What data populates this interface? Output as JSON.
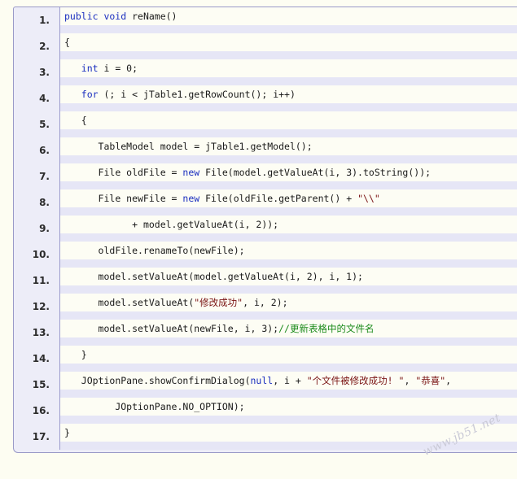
{
  "code": {
    "lines": [
      {
        "number": "1.",
        "indent": 0,
        "tokens": [
          {
            "t": "kw",
            "v": "public void"
          },
          {
            "t": "plain",
            "v": " reName()"
          }
        ]
      },
      {
        "number": "2.",
        "indent": 0,
        "tokens": [
          {
            "t": "plain",
            "v": "{"
          }
        ]
      },
      {
        "number": "3.",
        "indent": 3,
        "tokens": [
          {
            "t": "kw",
            "v": "int"
          },
          {
            "t": "plain",
            "v": " i = 0;"
          }
        ]
      },
      {
        "number": "4.",
        "indent": 3,
        "tokens": [
          {
            "t": "kw",
            "v": "for"
          },
          {
            "t": "plain",
            "v": " (; i < jTable1.getRowCount(); i++)"
          }
        ]
      },
      {
        "number": "5.",
        "indent": 3,
        "tokens": [
          {
            "t": "plain",
            "v": "{"
          }
        ]
      },
      {
        "number": "6.",
        "indent": 6,
        "tokens": [
          {
            "t": "plain",
            "v": "TableModel model = jTable1.getModel();"
          }
        ]
      },
      {
        "number": "7.",
        "indent": 6,
        "tokens": [
          {
            "t": "plain",
            "v": "File oldFile = "
          },
          {
            "t": "kw",
            "v": "new"
          },
          {
            "t": "plain",
            "v": " File(model.getValueAt(i, 3).toString());"
          }
        ]
      },
      {
        "number": "8.",
        "indent": 6,
        "tokens": [
          {
            "t": "plain",
            "v": "File newFile = "
          },
          {
            "t": "kw",
            "v": "new"
          },
          {
            "t": "plain",
            "v": " File(oldFile.getParent() + "
          },
          {
            "t": "str",
            "v": "\"\\\\\""
          }
        ]
      },
      {
        "number": "9.",
        "indent": 12,
        "tokens": [
          {
            "t": "plain",
            "v": "+ model.getValueAt(i, 2));"
          }
        ]
      },
      {
        "number": "10.",
        "indent": 6,
        "tokens": [
          {
            "t": "plain",
            "v": "oldFile.renameTo(newFile);"
          }
        ]
      },
      {
        "number": "11.",
        "indent": 6,
        "tokens": [
          {
            "t": "plain",
            "v": "model.setValueAt(model.getValueAt(i, 2), i, 1);"
          }
        ]
      },
      {
        "number": "12.",
        "indent": 6,
        "tokens": [
          {
            "t": "plain",
            "v": "model.setValueAt("
          },
          {
            "t": "str",
            "v": "\"修改成功\""
          },
          {
            "t": "plain",
            "v": ", i, 2);"
          }
        ]
      },
      {
        "number": "13.",
        "indent": 6,
        "tokens": [
          {
            "t": "plain",
            "v": "model.setValueAt(newFile, i, 3);"
          },
          {
            "t": "cm",
            "v": "//更新表格中的文件名"
          }
        ]
      },
      {
        "number": "14.",
        "indent": 3,
        "tokens": [
          {
            "t": "plain",
            "v": "}"
          }
        ]
      },
      {
        "number": "15.",
        "indent": 3,
        "tokens": [
          {
            "t": "plain",
            "v": "JOptionPane.showConfirmDialog("
          },
          {
            "t": "kw",
            "v": "null"
          },
          {
            "t": "plain",
            "v": ", i + "
          },
          {
            "t": "str",
            "v": "\"个文件被修改成功! \""
          },
          {
            "t": "plain",
            "v": ", "
          },
          {
            "t": "str",
            "v": "\"恭喜\""
          },
          {
            "t": "plain",
            "v": ","
          }
        ]
      },
      {
        "number": "16.",
        "indent": 9,
        "tokens": [
          {
            "t": "plain",
            "v": "JOptionPane.NO_OPTION);"
          }
        ]
      },
      {
        "number": "17.",
        "indent": 0,
        "tokens": [
          {
            "t": "plain",
            "v": "}"
          }
        ]
      }
    ]
  },
  "watermark": {
    "text": "www.jb51.net"
  },
  "colors": {
    "keyword": "#1b2fbf",
    "string": "#7a1414",
    "comment": "#1a8a1a",
    "gutter_border": "#9c9ccd",
    "stripe": "#e6e6f6"
  }
}
